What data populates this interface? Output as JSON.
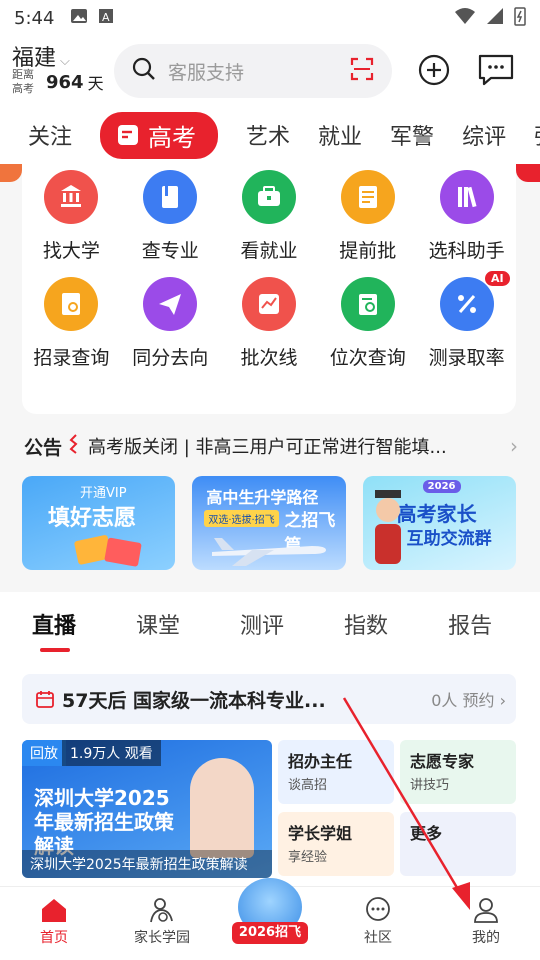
{
  "status_bar": {
    "time": "5:44"
  },
  "header": {
    "region": "福建",
    "countdown_line1": "距离",
    "countdown_line2": "高考",
    "countdown_days": "964",
    "countdown_unit": "天",
    "search_placeholder": "客服支持"
  },
  "top_tabs": [
    "关注",
    "高考",
    "艺术",
    "就业",
    "军警",
    "综评",
    "强"
  ],
  "quick_grid": [
    {
      "label": "找大学",
      "icon": "university-icon",
      "color": "#f0524c"
    },
    {
      "label": "查专业",
      "icon": "book-icon",
      "color": "#3d7cf2"
    },
    {
      "label": "看就业",
      "icon": "briefcase-icon",
      "color": "#21b45b"
    },
    {
      "label": "提前批",
      "icon": "document-icon",
      "color": "#f6a51e"
    },
    {
      "label": "选科助手",
      "icon": "subjects-icon",
      "color": "#9b4be8"
    },
    {
      "label": "招录查询",
      "icon": "search-doc-icon",
      "color": "#f6a51e"
    },
    {
      "label": "同分去向",
      "icon": "paper-plane-icon",
      "color": "#9b4be8"
    },
    {
      "label": "批次线",
      "icon": "line-chart-icon",
      "color": "#f0524c"
    },
    {
      "label": "位次查询",
      "icon": "clipboard-search-icon",
      "color": "#21b45b"
    },
    {
      "label": "测录取率",
      "icon": "percent-icon",
      "color": "#3d7cf2",
      "badge": "AI"
    }
  ],
  "notice": {
    "label": "公告",
    "text": "高考版关闭 | 非高三用户可正常进行智能填..."
  },
  "banners": [
    {
      "line1": "开通VIP",
      "line2": "填好志愿"
    },
    {
      "line1": "高中生升学路径",
      "line2": "之招飞篇",
      "tags": "双选·选拔·招飞"
    },
    {
      "year": "2026",
      "line1": "高考家长",
      "line2": "互助交流群"
    }
  ],
  "content_tabs": [
    "直播",
    "课堂",
    "测评",
    "指数",
    "报告"
  ],
  "live": {
    "title": "57天后 国家级一流本科专业...",
    "reserve": "0人 预约",
    "video_tag": "回放",
    "video_views": "1.9万人 观看",
    "video_title": "深圳大学2025年最新招生政策解读",
    "video_caption": "深圳大学2025年最新招生政策解读"
  },
  "mini_cards": [
    {
      "title": "招办主任",
      "sub": "谈高招"
    },
    {
      "title": "志愿专家",
      "sub": "讲技巧"
    },
    {
      "title": "学长学姐",
      "sub": "享经验"
    },
    {
      "title": "更多",
      "sub": ""
    }
  ],
  "bottom_nav": [
    "首页",
    "家长学园",
    "2026招飞",
    "社区",
    "我的"
  ]
}
